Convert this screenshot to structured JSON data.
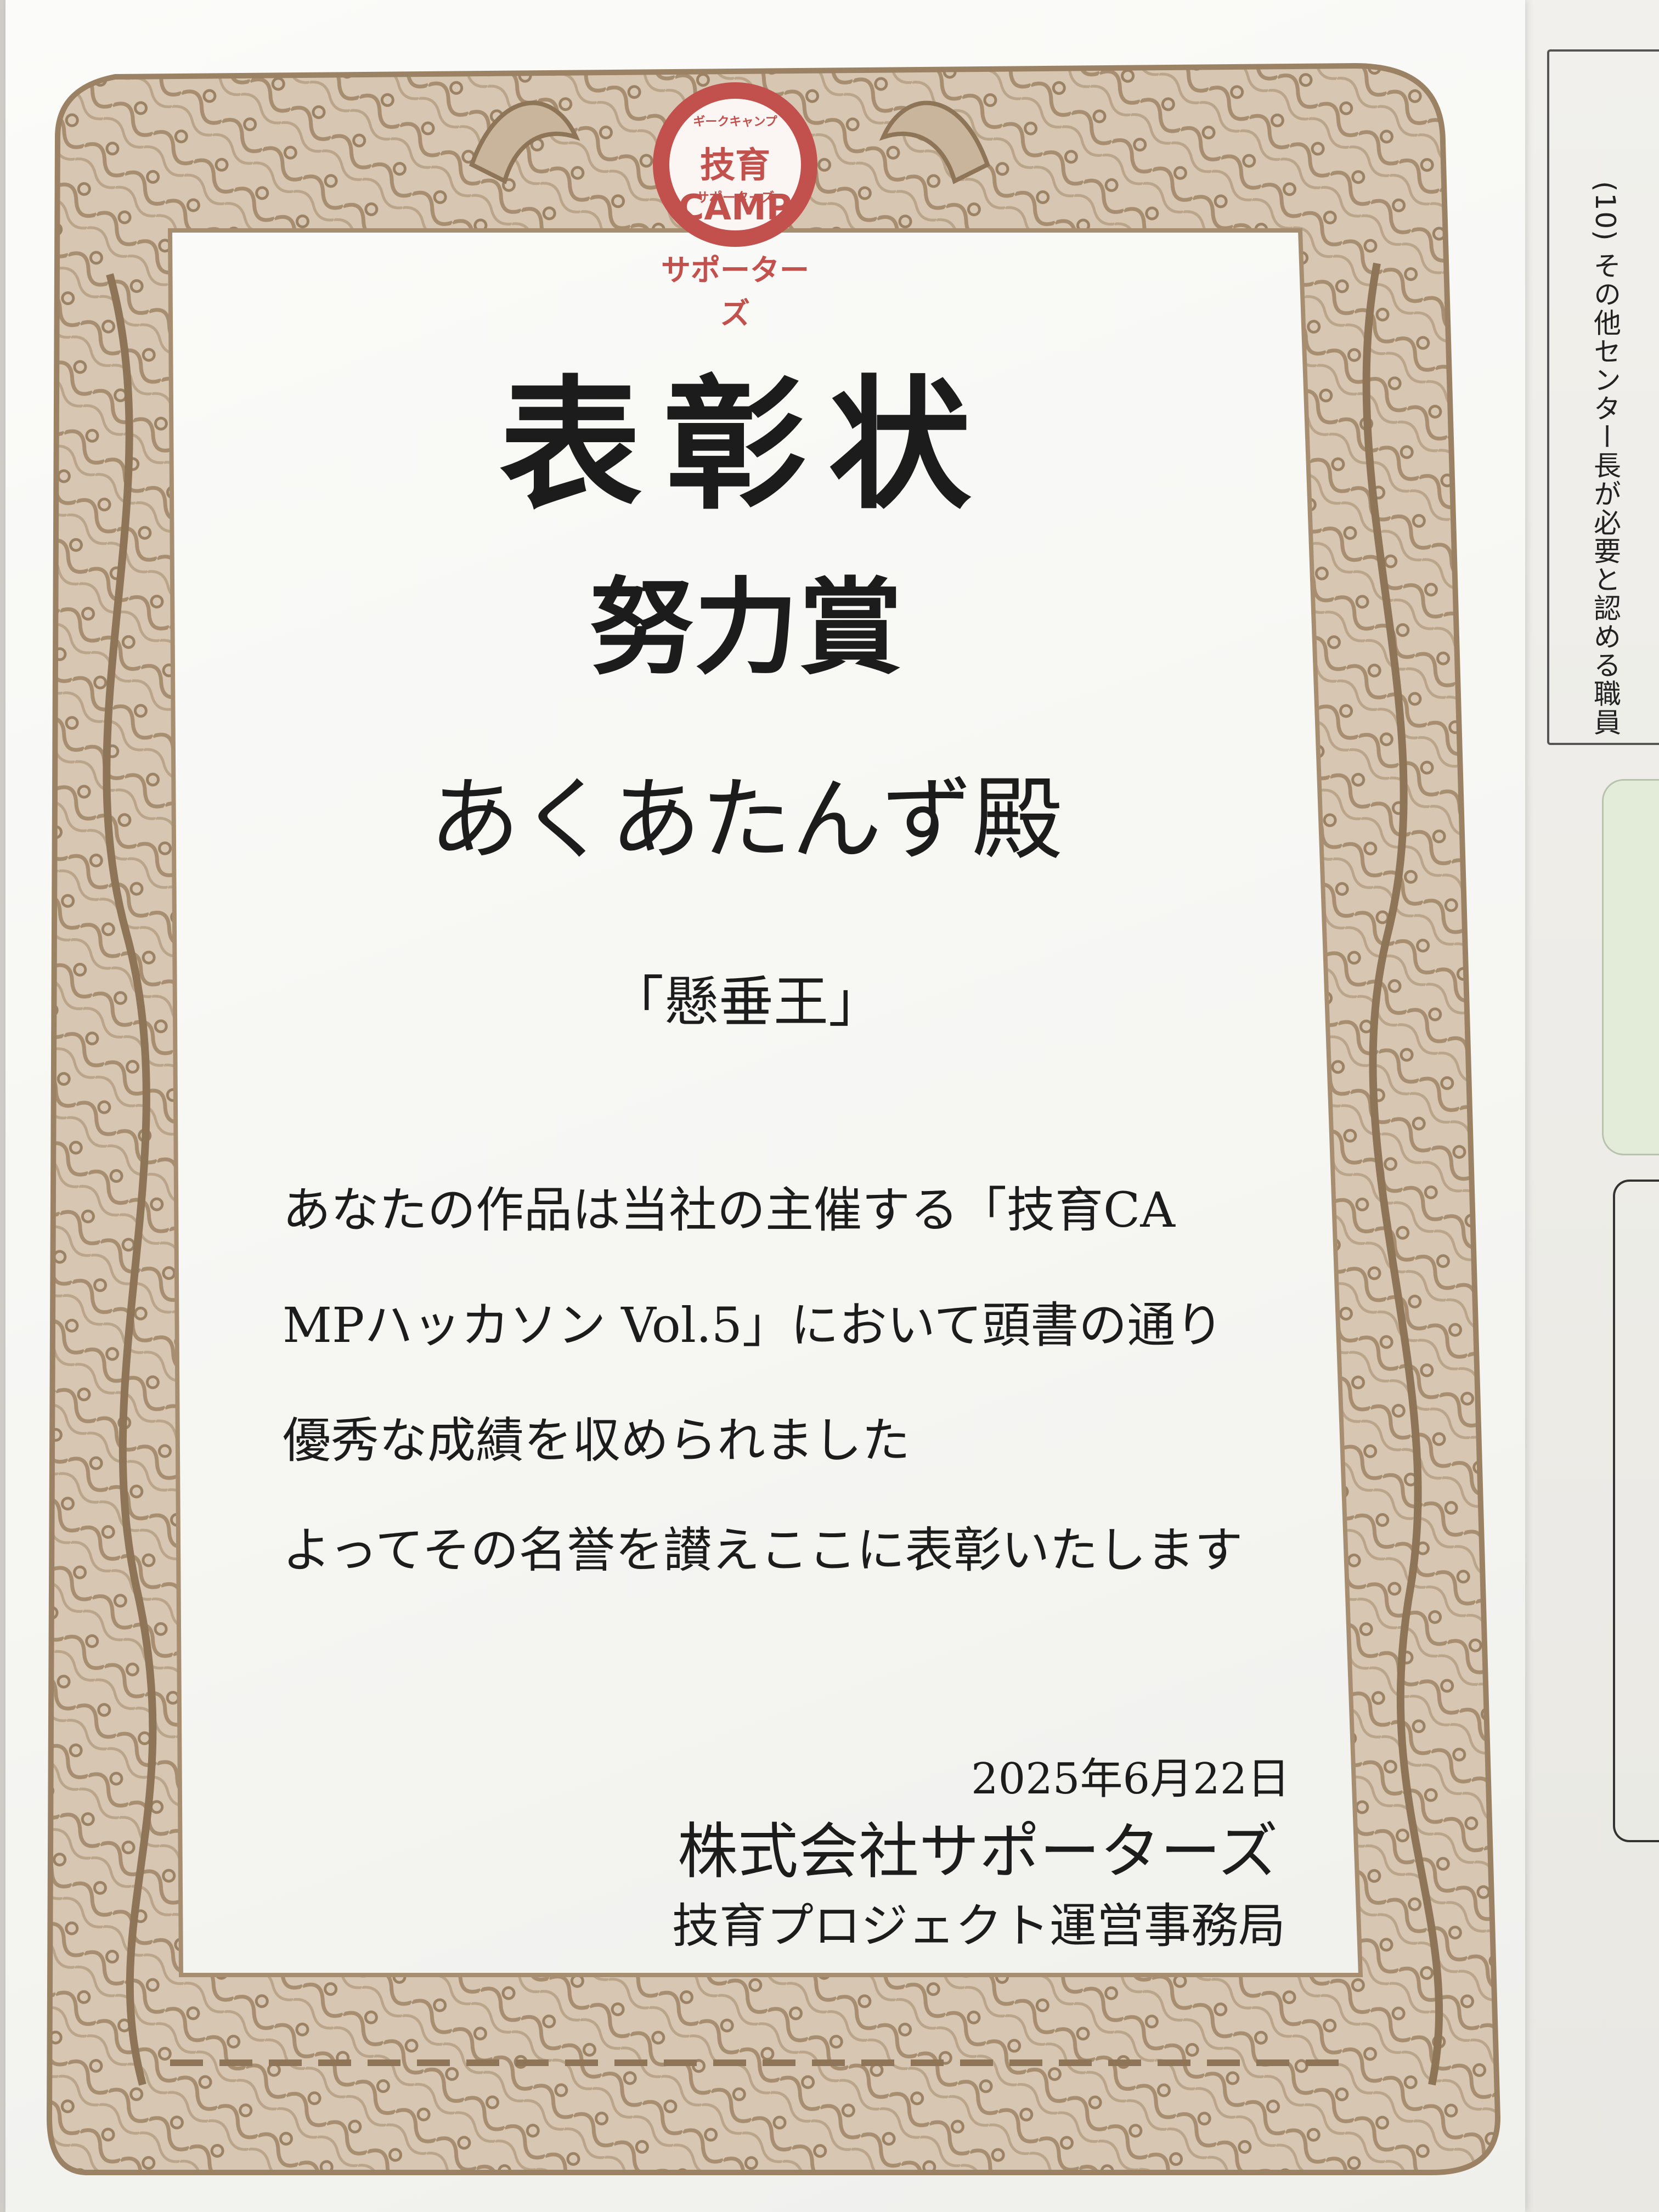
{
  "side_sheet": {
    "vertical_text": "(10) その他センター長が必要と認める職員"
  },
  "logo": {
    "top_text": "ギークキャンプ",
    "main_text": "技育CAMP",
    "sub_text": "サポーターズ",
    "caption": "サポーターズ"
  },
  "certificate": {
    "title": "表彰状",
    "award": "努力賞",
    "recipient": "あくあたんず殿",
    "nickname": "「懸垂王」",
    "body_lines": [
      "あなたの作品は当社の主催する「技育CA",
      "MPハッカソン Vol.5」において頭書の通り",
      "優秀な成績を収められました",
      "よってその名誉を讃えここに表彰いたします"
    ],
    "date": "2025年6月22日",
    "company": "株式会社サポーターズ",
    "department": "技育プロジェクト運営事務局"
  },
  "colors": {
    "frame_gold": "#b29a7e",
    "logo_red": "#c2504c",
    "text": "#1c1c1c"
  }
}
